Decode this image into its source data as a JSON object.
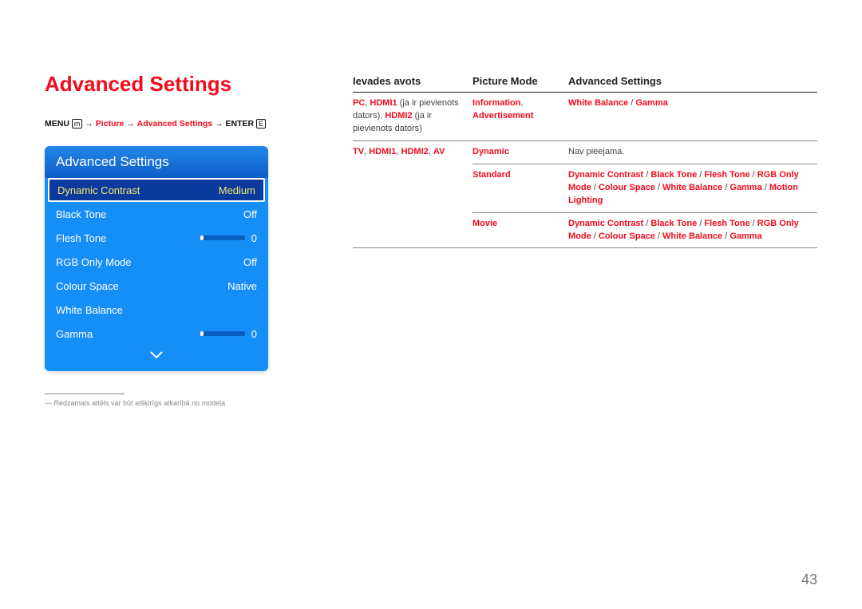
{
  "title": "Advanced Settings",
  "breadcrumb": {
    "menu": "MENU",
    "menu_icon": "m",
    "picture": "Picture",
    "advanced": "Advanced Settings",
    "enter": "ENTER",
    "enter_icon": "E"
  },
  "osd": {
    "header": "Advanced Settings",
    "rows": [
      {
        "label": "Dynamic Contrast",
        "value": "Medium",
        "selected": true
      },
      {
        "label": "Black Tone",
        "value": "Off"
      },
      {
        "label": "Flesh Tone",
        "value": "0",
        "slider": true
      },
      {
        "label": "RGB Only Mode",
        "value": "Off"
      },
      {
        "label": "Colour Space",
        "value": "Native"
      },
      {
        "label": "White Balance",
        "value": ""
      },
      {
        "label": "Gamma",
        "value": "0",
        "slider": true
      }
    ]
  },
  "footnote": "― Redzamais attēls var būt atšķirīgs atkarībā no modeļa.",
  "table": {
    "headers": [
      "Ievades avots",
      "Picture Mode",
      "Advanced Settings"
    ],
    "rows": [
      {
        "src_html": "<span class='red'>PC</span><span class='plain'>, </span><span class='red'>HDMI1</span><span class='plain'> (ja ir pievienots dators), </span><span class='red'>HDMI2</span><span class='plain'> (ja ir pievienots dators)</span>",
        "mode_html": "<span class='red'>Information</span><span class='plain'>, </span><span class='red'>Advertisement</span>",
        "adv_html": "<span class='red'>White Balance</span><span class='plain'> / </span><span class='red'>Gamma</span>"
      },
      {
        "src_html": "<span class='red'>TV</span><span class='plain'>, </span><span class='red'>HDMI1</span><span class='plain'>, </span><span class='red'>HDMI2</span><span class='plain'>, </span><span class='red'>AV</span>",
        "src_rowspan": 3,
        "mode_html": "<span class='red'>Dynamic</span>",
        "adv_html": "<span class='plain'>Nav pieejama.</span>"
      },
      {
        "mode_html": "<span class='red'>Standard</span>",
        "adv_html": "<span class='red'>Dynamic Contrast</span><span class='plain'> / </span><span class='red'>Black Tone</span><span class='plain'> / </span><span class='red'>Flesh Tone</span><span class='plain'> / </span><span class='red'>RGB Only Mode</span><span class='plain'> / </span><span class='red'>Colour Space</span><span class='plain'> / </span><span class='red'>White Balance</span><span class='plain'> / </span><span class='red'>Gamma</span><span class='plain'> / </span><span class='red'>Motion Lighting</span>"
      },
      {
        "mode_html": "<span class='red'>Movie</span>",
        "adv_html": "<span class='red'>Dynamic Contrast</span><span class='plain'> / </span><span class='red'>Black Tone</span><span class='plain'> / </span><span class='red'>Flesh Tone</span><span class='plain'> / </span><span class='red'>RGB Only Mode</span><span class='plain'> / </span><span class='red'>Colour Space</span><span class='plain'> / </span><span class='red'>White Balance</span><span class='plain'> / </span><span class='red'>Gamma</span>"
      }
    ]
  },
  "page_number": "43"
}
